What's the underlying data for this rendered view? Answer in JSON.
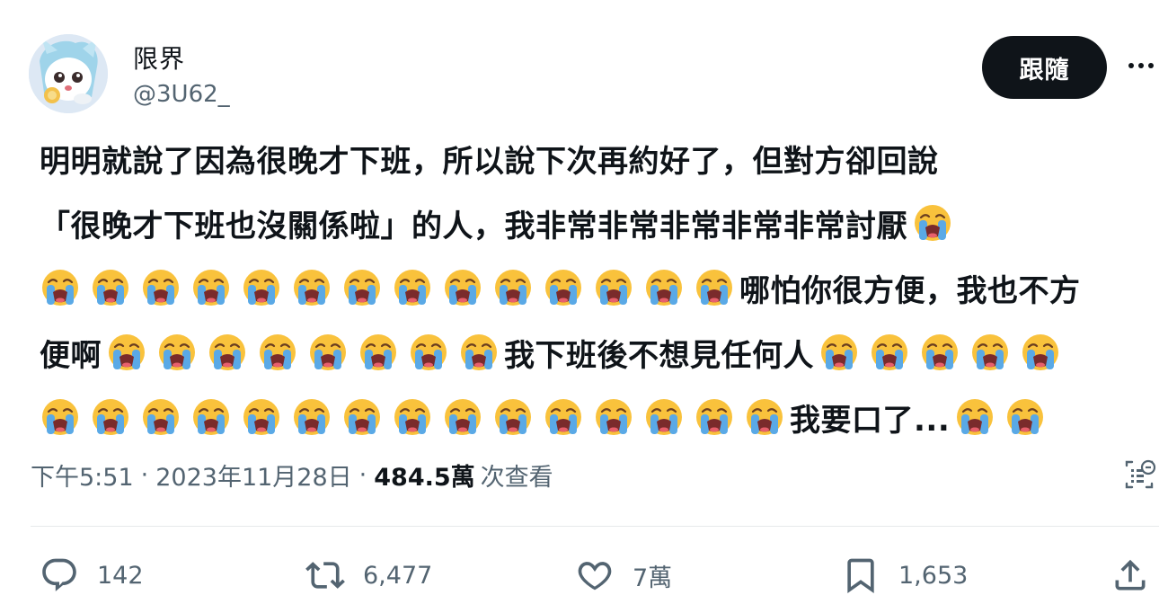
{
  "author": {
    "name": "限界",
    "handle": "@3U62_"
  },
  "follow_label": "跟隨",
  "tweet": {
    "lines": [
      [
        {
          "t": "明明就說了因為很晚才下班，所以說下次再約好了，但對方卻回說"
        }
      ],
      [
        {
          "t": "「很晚才下班也沒關係啦」的人，我非常非常非常非常非常討厭"
        },
        {
          "e": 1
        }
      ],
      [
        {
          "e": 14
        },
        {
          "t": "哪怕你很方便，我也不方"
        }
      ],
      [
        {
          "t": "便啊"
        },
        {
          "e": 8
        },
        {
          "t": "我下班後不想見任何人"
        },
        {
          "e": 5
        }
      ],
      [
        {
          "e": 15
        },
        {
          "t": "我要口了..."
        },
        {
          "e": 2
        }
      ]
    ],
    "emoji_icon": "loudly-crying-face-icon"
  },
  "meta": {
    "time": "下午5:51",
    "date": "2023年11月28日",
    "separator": "·",
    "views_count": "484.5萬",
    "views_label": "次查看"
  },
  "actions": {
    "reply_count": "142",
    "retweet_count": "6,477",
    "like_count": "7萬",
    "bookmark_count": "1,653"
  },
  "colors": {
    "text": "#0f1419",
    "secondary": "#536471",
    "button": "#0f1419",
    "divider": "#e7e9ea"
  }
}
